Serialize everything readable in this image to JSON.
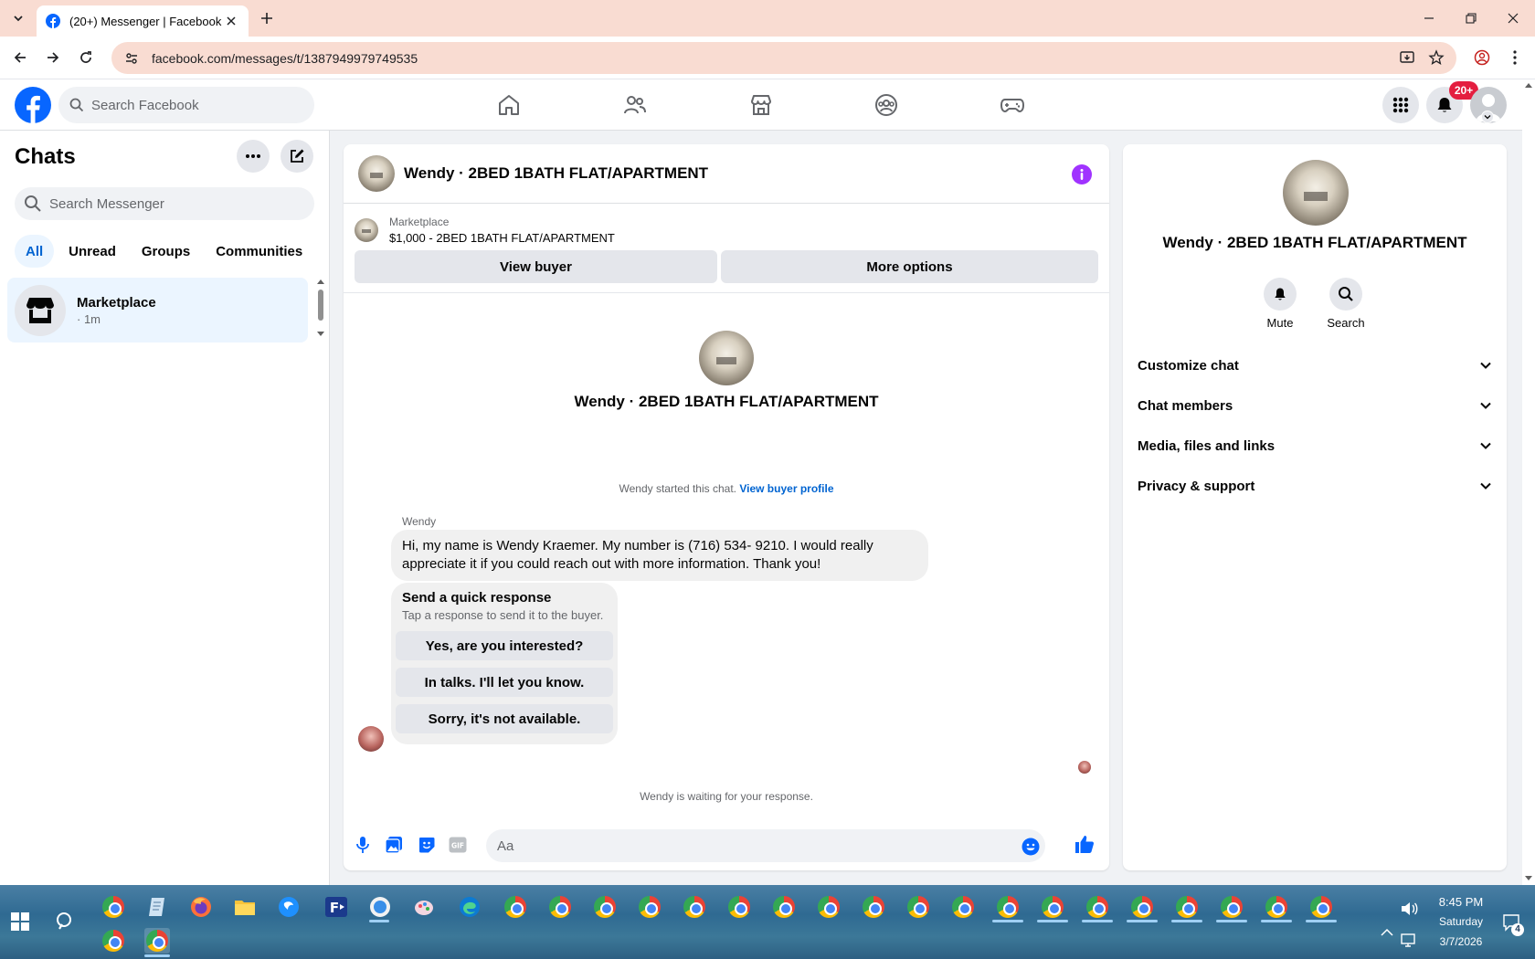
{
  "browser": {
    "tab_title": "(20+) Messenger | Facebook",
    "url": "facebook.com/messages/t/1387949979749535"
  },
  "fb_header": {
    "search_placeholder": "Search Facebook",
    "notification_badge": "20+"
  },
  "sidebar": {
    "title": "Chats",
    "search_placeholder": "Search Messenger",
    "filters": [
      "All",
      "Unread",
      "Groups",
      "Communities"
    ],
    "active_filter": "All",
    "chats": [
      {
        "name": "Marketplace",
        "time": "· 1m"
      }
    ]
  },
  "conversation": {
    "title": "Wendy · 2BED 1BATH FLAT/APARTMENT",
    "listing_source": "Marketplace",
    "listing_text": "$1,000 - 2BED 1BATH FLAT/APARTMENT",
    "view_buyer": "View buyer",
    "more_options": "More options",
    "started_text": "Wendy started this chat.",
    "view_buyer_profile": "View buyer profile",
    "sender": "Wendy",
    "message": "Hi, my name is Wendy Kraemer. My number is (716) 534- 9210. I would really appreciate it if you could reach out with more information. Thank you!",
    "quick_title": "Send a quick response",
    "quick_subtitle": "Tap a response to send it to the buyer.",
    "quick_replies": [
      "Yes, are you interested?",
      "In talks. I'll let you know.",
      "Sorry, it's not available."
    ],
    "waiting": "Wendy is waiting for your response.",
    "composer_placeholder": "Aa"
  },
  "details": {
    "name": "Wendy · 2BED 1BATH FLAT/APARTMENT",
    "mute": "Mute",
    "search": "Search",
    "sections": [
      "Customize chat",
      "Chat members",
      "Media, files and links",
      "Privacy & support"
    ]
  },
  "taskbar": {
    "time": "8:45 PM",
    "day": "Saturday",
    "date": "3/7/2026",
    "notifications": "4"
  },
  "colors": {
    "fb_blue": "#0866ff",
    "accent_purple": "#a033ff",
    "tab_strip": "#f9dcd2",
    "selected_chat": "#ebf5ff",
    "badge_red": "#e41e3f"
  }
}
